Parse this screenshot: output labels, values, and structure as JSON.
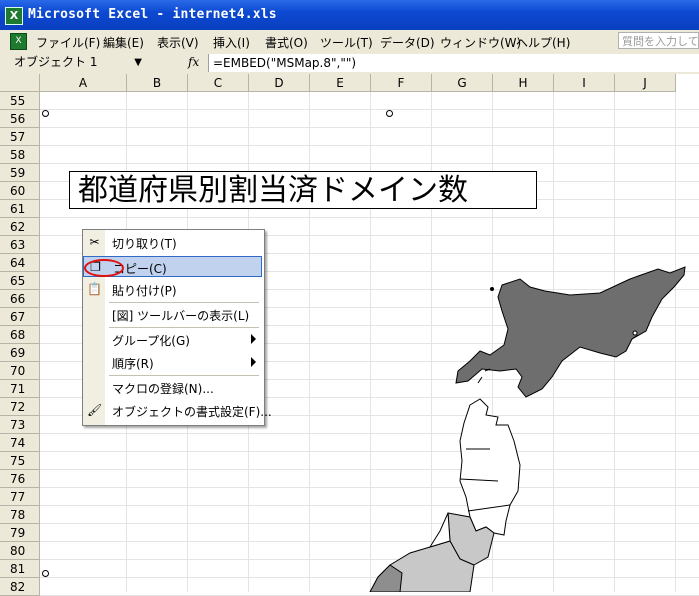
{
  "window": {
    "title": "Microsoft Excel - internet4.xls",
    "app_icon": "excel-icon"
  },
  "menubar": {
    "items": [
      "ファイル(F)",
      "編集(E)",
      "表示(V)",
      "挿入(I)",
      "書式(O)",
      "ツール(T)",
      "データ(D)",
      "ウィンドウ(W)",
      "ヘルプ(H)"
    ],
    "help_placeholder": "質問を入力して"
  },
  "formulabar": {
    "name_box": "オブジェクト 1",
    "fx_label": "fx",
    "formula": "=EMBED(\"MSMap.8\",\"\")"
  },
  "columns": [
    "A",
    "B",
    "C",
    "D",
    "E",
    "F",
    "G",
    "H",
    "I",
    "J"
  ],
  "rows": [
    "55",
    "56",
    "57",
    "58",
    "59",
    "60",
    "61",
    "62",
    "63",
    "64",
    "65",
    "66",
    "67",
    "68",
    "69",
    "70",
    "71",
    "72",
    "73",
    "74",
    "75",
    "76",
    "77",
    "78",
    "79",
    "80",
    "81",
    "82"
  ],
  "sheet": {
    "title": "都道府県別割当済ドメイン数"
  },
  "context_menu": {
    "items": [
      {
        "label": "切り取り(T)",
        "icon": "scissors-icon"
      },
      {
        "label": "コピー(C)",
        "icon": "copy-icon",
        "selected": true
      },
      {
        "label": "貼り付け(P)",
        "icon": "paste-icon"
      },
      {
        "label": "[図] ツールバーの表示(L)",
        "icon": ""
      },
      {
        "label": "グループ化(G)",
        "icon": "",
        "submenu": true
      },
      {
        "label": "順序(R)",
        "icon": "",
        "submenu": true
      },
      {
        "label": "マクロの登録(N)...",
        "icon": ""
      },
      {
        "label": "オブジェクトの書式設定(F)...",
        "icon": "format-object-icon"
      }
    ]
  },
  "colors": {
    "titlebar": "#0c49d2",
    "selection": "#c1d2ee",
    "highlight_circle": "#e01010",
    "map_hokkaido": "#6e6e6e",
    "map_gray": "#c8c8c8"
  }
}
